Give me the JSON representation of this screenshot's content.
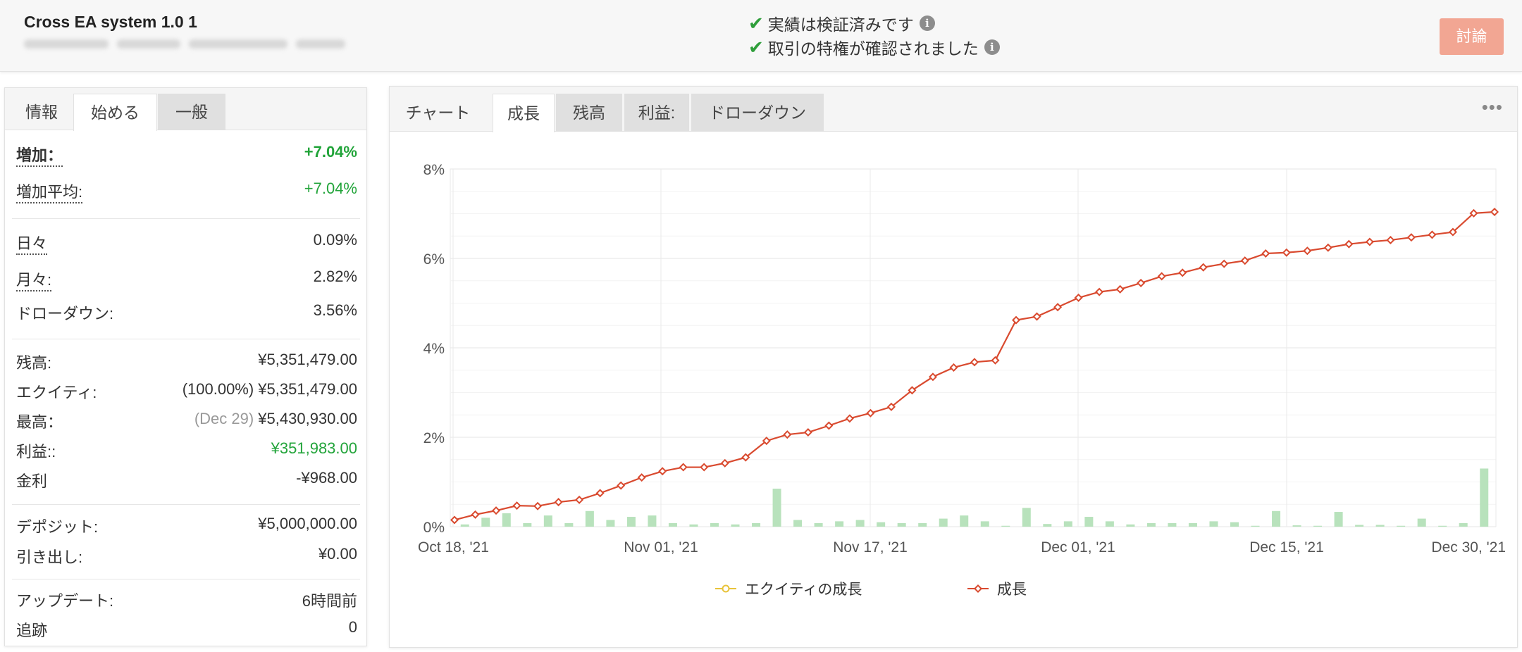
{
  "header": {
    "title": "Cross EA system 1.0 1",
    "verified_1": "実績は検証済みです",
    "verified_2": "取引の特権が確認されました",
    "discuss_label": "討論"
  },
  "left_tabs": [
    "情報",
    "始める",
    "一般"
  ],
  "stats": {
    "gain_label": "増加：",
    "gain_value": "+7.04%",
    "avg_gain_label": "増加平均:",
    "avg_gain_value": "+7.04%",
    "daily_label": "日々",
    "daily_value": "0.09%",
    "monthly_label": "月々:",
    "monthly_value": "2.82%",
    "drawdown_label": "ドローダウン:",
    "drawdown_value": "3.56%",
    "balance_label": "残高:",
    "balance_value": "¥5,351,479.00",
    "equity_label": "エクイティ:",
    "equity_value": "(100.00%) ¥5,351,479.00",
    "highest_label": "最高：",
    "highest_note": "(Dec 29)",
    "highest_value": "¥5,430,930.00",
    "profit_label": "利益::",
    "profit_value": "¥351,983.00",
    "interest_label": "金利",
    "interest_value": "-¥968.00",
    "deposit_label": "デポジット:",
    "deposit_value": "¥5,000,000.00",
    "withdraw_label": "引き出し:",
    "withdraw_value": "¥0.00",
    "update_label": "アップデート:",
    "update_value": "6時間前",
    "track_label": "追跡",
    "track_value": "0"
  },
  "right_tabs": [
    "チャート",
    "成長",
    "残高",
    "利益:",
    "ドローダウン"
  ],
  "more_label": "•••",
  "chart_data": {
    "type": "line",
    "y_ticks": [
      "8%",
      "6%",
      "4%",
      "2%",
      "0%"
    ],
    "ylim": [
      0,
      8
    ],
    "x_ticks": [
      "Oct 18, '21",
      "Nov 01, '21",
      "Nov 17, '21",
      "Dec 01, '21",
      "Dec 15, '21",
      "Dec 30, '21"
    ],
    "grid": true,
    "legend_position": "bottom",
    "series": [
      {
        "name": "成長",
        "color": "#d94a2f",
        "marker": "diamond",
        "values": [
          0.15,
          0.27,
          0.36,
          0.47,
          0.46,
          0.55,
          0.6,
          0.75,
          0.92,
          1.1,
          1.24,
          1.33,
          1.33,
          1.42,
          1.55,
          1.92,
          2.06,
          2.11,
          2.26,
          2.42,
          2.54,
          2.68,
          3.05,
          3.35,
          3.56,
          3.68,
          3.72,
          4.62,
          4.7,
          4.91,
          5.12,
          5.25,
          5.31,
          5.45,
          5.6,
          5.68,
          5.8,
          5.88,
          5.95,
          6.11,
          6.13,
          6.17,
          6.24,
          6.32,
          6.37,
          6.41,
          6.47,
          6.53,
          6.59,
          7.01,
          7.04
        ]
      },
      {
        "name": "エクイティの成長",
        "color": "#e8c33a",
        "marker": "circle",
        "values": []
      }
    ],
    "bars": {
      "color": "#b8e2bc",
      "values": [
        0.05,
        0.2,
        0.3,
        0.08,
        0.25,
        0.08,
        0.35,
        0.15,
        0.22,
        0.25,
        0.08,
        0.05,
        0.08,
        0.05,
        0.08,
        0.85,
        0.15,
        0.08,
        0.12,
        0.15,
        0.1,
        0.08,
        0.08,
        0.18,
        0.25,
        0.12,
        0.02,
        0.42,
        0.06,
        0.12,
        0.22,
        0.12,
        0.05,
        0.08,
        0.08,
        0.08,
        0.12,
        0.1,
        0.02,
        0.35,
        0.03,
        0.02,
        0.33,
        0.04,
        0.04,
        0.02,
        0.18,
        0.02,
        0.08,
        1.3,
        0.05
      ]
    }
  }
}
